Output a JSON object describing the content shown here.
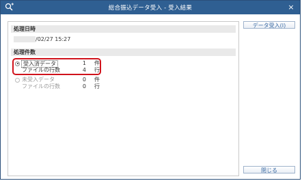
{
  "window": {
    "title": "総合振込データ受入 - 受入結果",
    "close_icon": "×",
    "title_icon": "search-plus-icon"
  },
  "processing_datetime": {
    "header": "処理日時",
    "value": "/02/27 15:27"
  },
  "processing_count": {
    "header": "処理件数",
    "options": [
      {
        "label": "受入済データ",
        "count": "1",
        "unit": "件",
        "selected": true,
        "enabled": true
      },
      {
        "label": "ファイルの行数",
        "count": "4",
        "unit": "行",
        "enabled": true
      },
      {
        "label": "未受入データ",
        "count": "0",
        "unit": "件",
        "selected": false,
        "enabled": false
      },
      {
        "label": "ファイルの行数",
        "count": "0",
        "unit": "行",
        "enabled": false
      }
    ]
  },
  "buttons": {
    "data_import": "データ受入(I)",
    "close": "閉じる"
  },
  "colors": {
    "titlebar": "#2f5f92",
    "highlight": "#d0121b",
    "button_text": "#3a6aa3"
  }
}
